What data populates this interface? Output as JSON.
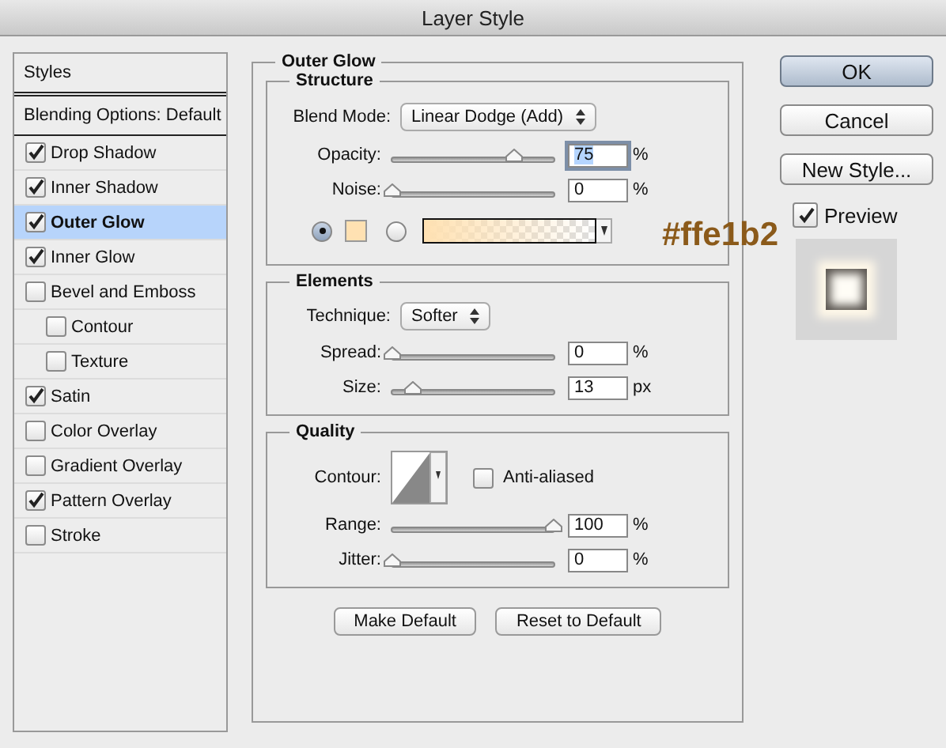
{
  "window": {
    "title": "Layer Style"
  },
  "styles": {
    "header": "Styles",
    "blending": "Blending Options: Default",
    "effects": [
      {
        "label": "Drop Shadow",
        "checked": true,
        "selected": false
      },
      {
        "label": "Inner Shadow",
        "checked": true,
        "selected": false
      },
      {
        "label": "Outer Glow",
        "checked": true,
        "selected": true
      },
      {
        "label": "Inner Glow",
        "checked": true,
        "selected": false
      },
      {
        "label": "Bevel and Emboss",
        "checked": false,
        "selected": false,
        "children": [
          {
            "label": "Contour",
            "checked": false,
            "selected": false
          },
          {
            "label": "Texture",
            "checked": false,
            "selected": false
          }
        ]
      },
      {
        "label": "Satin",
        "checked": true,
        "selected": false
      },
      {
        "label": "Color Overlay",
        "checked": false,
        "selected": false
      },
      {
        "label": "Gradient Overlay",
        "checked": false,
        "selected": false
      },
      {
        "label": "Pattern Overlay",
        "checked": true,
        "selected": false
      },
      {
        "label": "Stroke",
        "checked": false,
        "selected": false
      }
    ]
  },
  "outer_glow": {
    "title": "Outer Glow",
    "structure": {
      "title": "Structure",
      "blend_mode": {
        "label": "Blend Mode:",
        "value": "Linear Dodge (Add)"
      },
      "sliders": [
        {
          "label": "Opacity:",
          "level": 0.75,
          "value": "75",
          "unit": "%",
          "focused": true
        },
        {
          "label": "Noise:",
          "level": 0,
          "value": "0",
          "unit": "%",
          "focused": false
        }
      ],
      "fill_options": [
        {
          "kind": "solid",
          "selected": true,
          "color": "#ffe1b2"
        },
        {
          "kind": "gradient",
          "selected": false,
          "color": "#ffe1b2"
        }
      ],
      "annotation": "#ffe1b2"
    },
    "elements": {
      "title": "Elements",
      "technique": {
        "label": "Technique:",
        "value": "Softer"
      },
      "sliders": [
        {
          "label": "Spread:",
          "level": 0,
          "value": "0",
          "unit": "%",
          "focused": false
        },
        {
          "label": "Size:",
          "level": 0.13,
          "value": "13",
          "unit": "px",
          "focused": false
        }
      ]
    },
    "quality": {
      "title": "Quality",
      "contour_label": "Contour:",
      "anti_aliased": {
        "label": "Anti-aliased",
        "checked": false
      },
      "sliders": [
        {
          "label": "Range:",
          "level": 1,
          "value": "100",
          "unit": "%",
          "focused": false
        },
        {
          "label": "Jitter:",
          "level": 0,
          "value": "0",
          "unit": "%",
          "focused": false
        }
      ]
    },
    "buttons": [
      "Make Default",
      "Reset to Default"
    ]
  },
  "actions": [
    {
      "label": "OK",
      "default": true
    },
    {
      "label": "Cancel",
      "default": false
    },
    {
      "label": "New Style...",
      "default": false
    }
  ],
  "preview": {
    "label": "Preview",
    "checked": true
  }
}
